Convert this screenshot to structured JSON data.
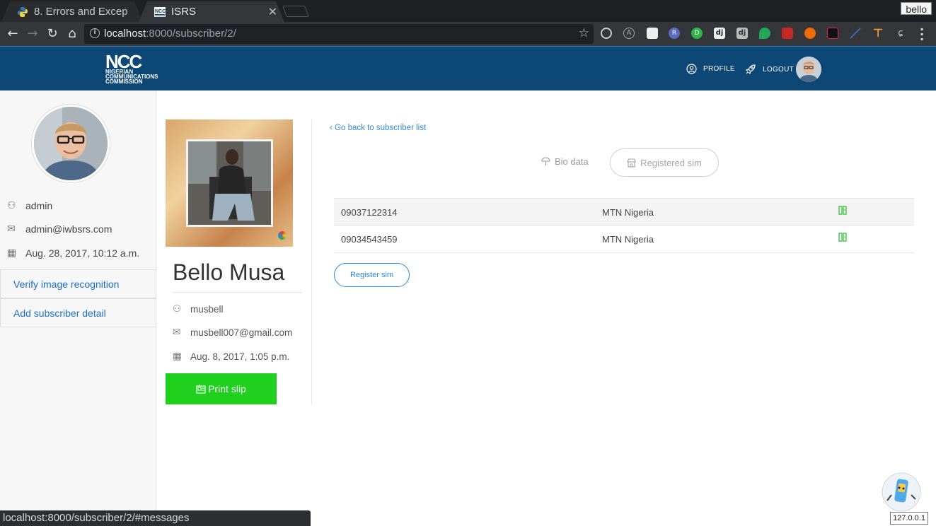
{
  "browser": {
    "tabs": [
      {
        "title": "8. Errors and Excep",
        "favicon": "python-icon",
        "active": false
      },
      {
        "title": "ISRS",
        "favicon": "ncc-icon",
        "active": true
      }
    ],
    "profile_name": "bello",
    "url_host": "localhost",
    "url_path": ":8000/subscriber/2/",
    "status_url": "localhost:8000/subscriber/2/#messages",
    "ip_label": "127.0.0.1"
  },
  "header": {
    "logo_big": "NCC",
    "logo_lines": [
      "NIGERIAN",
      "COMMUNICATIONS",
      "COMMISSION"
    ],
    "profile_label": "PROFILE",
    "logout_label": "LOGOUT"
  },
  "sidebar": {
    "username": "admin",
    "email": "admin@iwbsrs.com",
    "joined": "Aug. 28, 2017, 10:12 a.m.",
    "links": [
      {
        "label": "Verify image recognition"
      },
      {
        "label": "Add subscriber detail"
      }
    ]
  },
  "subscriber": {
    "name": "Bello Musa",
    "username": "musbell",
    "email": "musbell007@gmail.com",
    "date": "Aug. 8, 2017, 1:05 p.m.",
    "print_label": "Print slip"
  },
  "main": {
    "back_link": "Go back to subscriber list",
    "tabs": [
      {
        "label": "Bio data",
        "active": false
      },
      {
        "label": "Registered sim",
        "active": true
      }
    ],
    "sims": [
      {
        "number": "09037122314",
        "network": "MTN Nigeria"
      },
      {
        "number": "09034543459",
        "network": "MTN Nigeria"
      }
    ],
    "register_label": "Register sim"
  },
  "colors": {
    "header_bg": "#0c4775",
    "link": "#2f8ad9",
    "print_button": "#1fd01f",
    "sim_icon": "#32c432"
  }
}
